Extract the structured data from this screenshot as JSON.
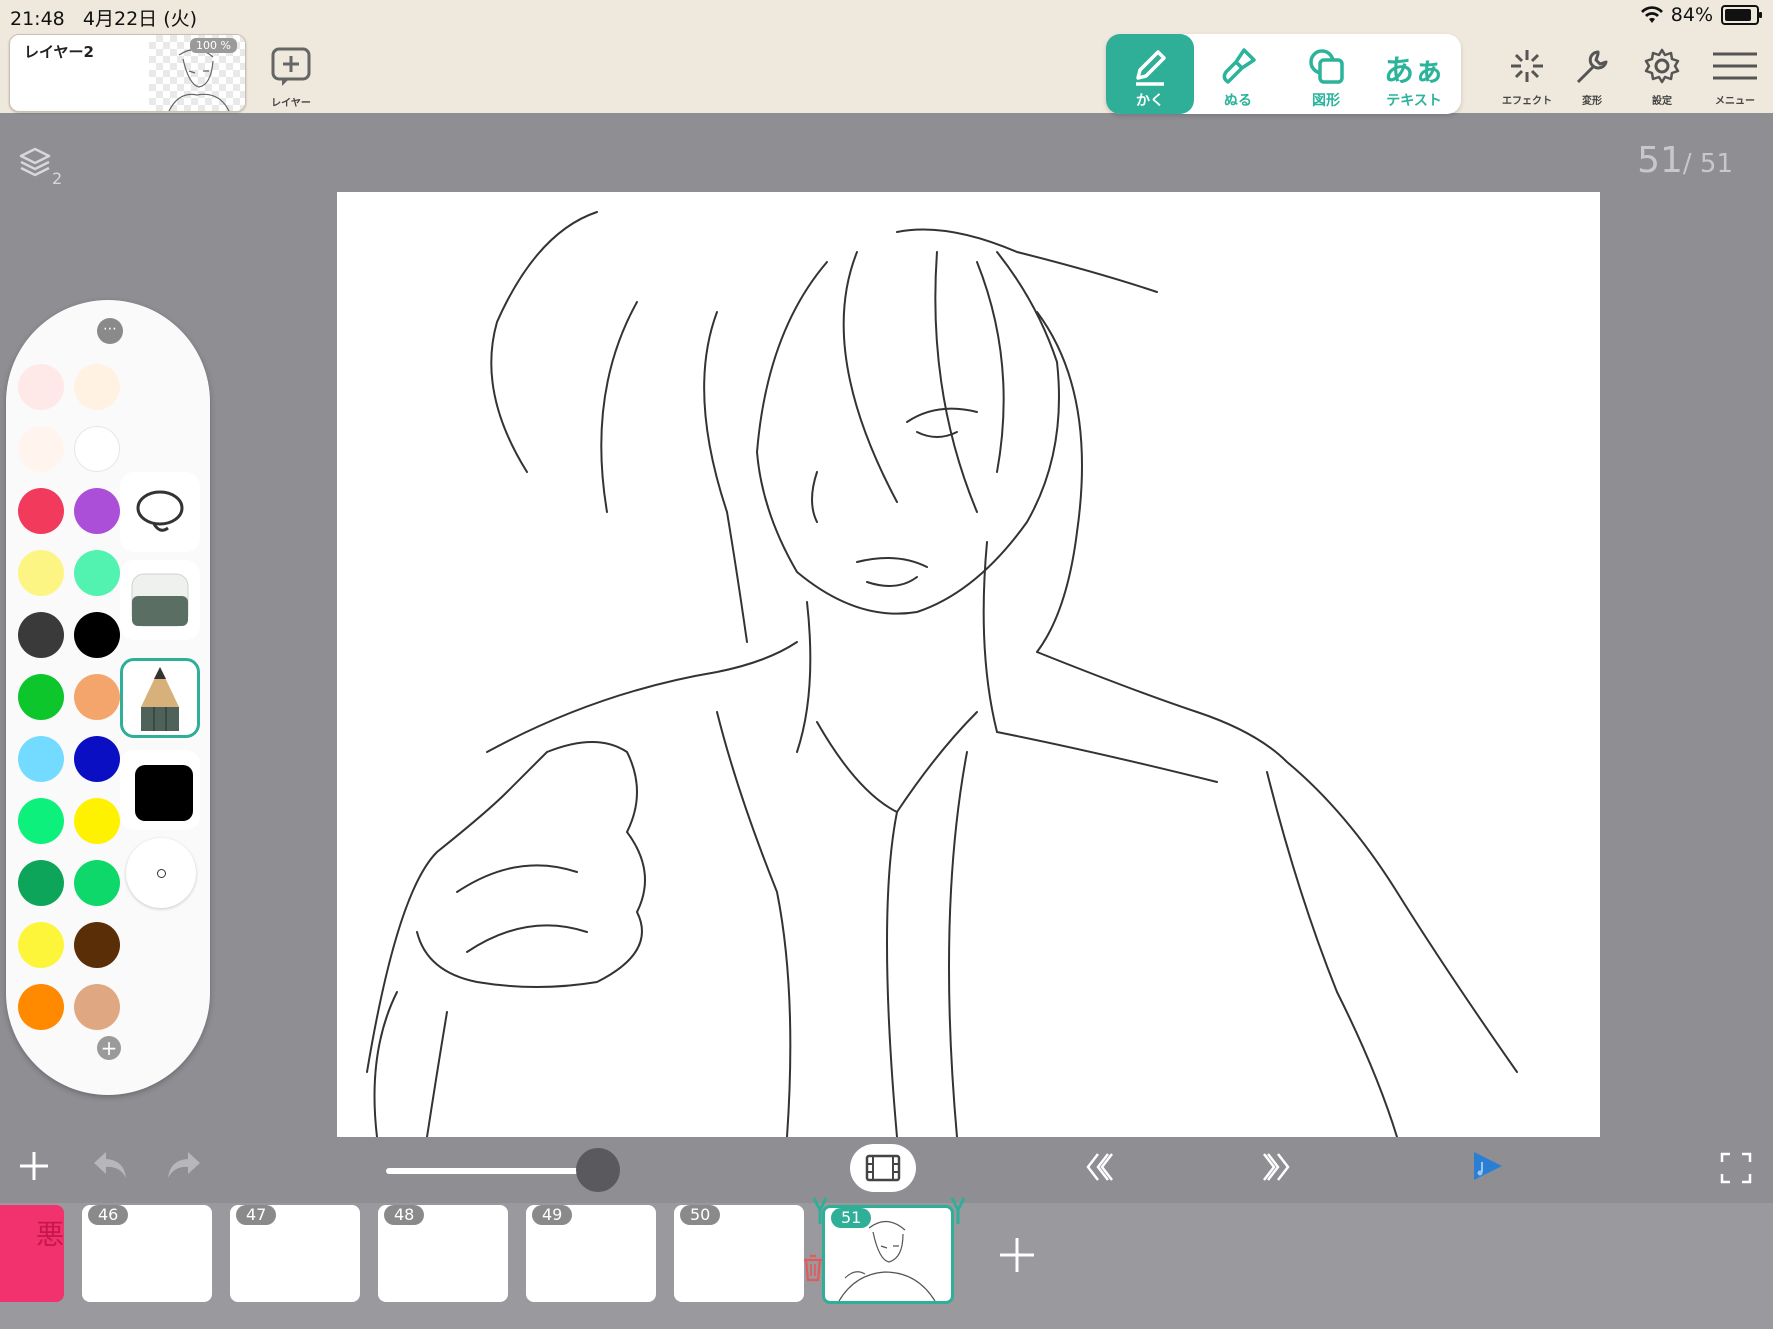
{
  "status": {
    "time": "21:48",
    "date": "4月22日 (火)",
    "battery": "84%"
  },
  "layer": {
    "name": "レイヤー2",
    "opacity": "100 %"
  },
  "add_layer_label": "レイヤー",
  "modes": [
    {
      "id": "draw",
      "label": "かく",
      "active": true
    },
    {
      "id": "fill",
      "label": "ぬる",
      "active": false
    },
    {
      "id": "shape",
      "label": "図形",
      "active": false
    },
    {
      "id": "text",
      "label": "テキスト",
      "icon_text": "あぁ",
      "active": false
    }
  ],
  "tools": [
    {
      "id": "effect",
      "label": "エフェクト"
    },
    {
      "id": "transform",
      "label": "変形"
    },
    {
      "id": "settings",
      "label": "設定"
    },
    {
      "id": "menu",
      "label": "メニュー"
    }
  ],
  "layer_count": "2",
  "frame_counter": {
    "current": "51",
    "total": "/ 51"
  },
  "palette": {
    "colors": [
      "#ffe8e8",
      "#fff2e2",
      "#fff4ee",
      "#ffffff",
      "#f23a5d",
      "#ac4fd8",
      "#fdf583",
      "#52f2b0",
      "#3a3a3a",
      "#000000",
      "#0dc62c",
      "#f3a56b",
      "#73dbff",
      "#0b0fc4",
      "#0ef07c",
      "#fff200",
      "#0ca55a",
      "#0fd86a",
      "#fdf53a",
      "#5a2e07",
      "#ff8a00",
      "#e0a882"
    ],
    "current_color": "#000000",
    "tools": [
      "lasso-tool",
      "eraser-tool",
      "pencil-tool"
    ]
  },
  "frames": [
    "46",
    "47",
    "48",
    "49",
    "50",
    "51"
  ],
  "first_frame_text": "悪",
  "accent": "#2fae98"
}
